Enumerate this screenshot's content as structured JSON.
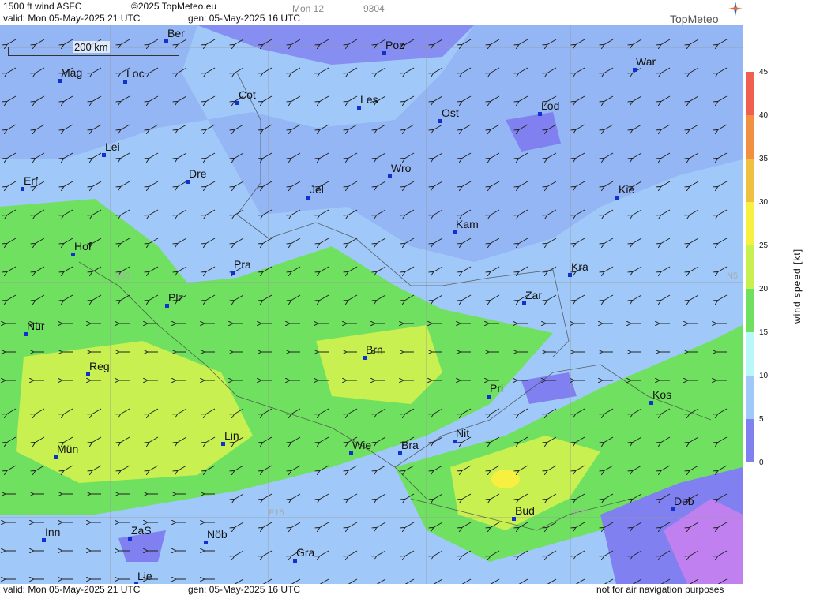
{
  "header": {
    "product": "1500 ft wind ASFC",
    "copyright": "©2025 TopMeteo.eu",
    "tab": "Mon 12",
    "code": "9304",
    "valid": "valid:  Mon  05-May-2025  21 UTC",
    "gen": "gen:  05-May-2025 16 UTC",
    "brand": "TopMeteo"
  },
  "map": {
    "scale_label": "200 km",
    "grid_labels": [
      {
        "name": "lat-n50",
        "text": "N50"
      },
      {
        "name": "lat-n5-edge",
        "text": "N5"
      },
      {
        "name": "lon-e15",
        "text": "E15"
      },
      {
        "name": "lon-e20",
        "text": "E20"
      }
    ],
    "cities": [
      {
        "label": "Ber"
      },
      {
        "label": "Poz"
      },
      {
        "label": "War"
      },
      {
        "label": "Mag"
      },
      {
        "label": "Loc"
      },
      {
        "label": "Cot"
      },
      {
        "label": "Les"
      },
      {
        "label": "Ost"
      },
      {
        "label": "Lod"
      },
      {
        "label": "Lei"
      },
      {
        "label": "Dre"
      },
      {
        "label": "Wro"
      },
      {
        "label": "Erf"
      },
      {
        "label": "Jel"
      },
      {
        "label": "Kie"
      },
      {
        "label": "Kam"
      },
      {
        "label": "Hof"
      },
      {
        "label": "Pra"
      },
      {
        "label": "Kra"
      },
      {
        "label": "Zar"
      },
      {
        "label": "Plz"
      },
      {
        "label": "Nür"
      },
      {
        "label": "Brn"
      },
      {
        "label": "Reg"
      },
      {
        "label": "Pri"
      },
      {
        "label": "Kos"
      },
      {
        "label": "Nit"
      },
      {
        "label": "Lin"
      },
      {
        "label": "Mün"
      },
      {
        "label": "Wie"
      },
      {
        "label": "Bra"
      },
      {
        "label": "Bud"
      },
      {
        "label": "Deb"
      },
      {
        "label": "Nöb"
      },
      {
        "label": "Inn"
      },
      {
        "label": "ZaS"
      },
      {
        "label": "Gra"
      },
      {
        "label": "Lie"
      }
    ]
  },
  "legend": {
    "unit": "wind  speed  [kt]",
    "ticks": [
      "45",
      "40",
      "35",
      "30",
      "25",
      "20",
      "15",
      "10",
      "5",
      "0"
    ],
    "colors": {
      "45": "#f06050",
      "40": "#f09040",
      "35": "#f0c040",
      "30": "#f8f040",
      "25": "#c8f050",
      "20": "#70e060",
      "15": "#b8f8f8",
      "10": "#a0c8f8",
      "5": "#8080f0",
      "0": "#c080f0"
    }
  },
  "footer": {
    "valid": "valid:  Mon  05-May-2025  21 UTC",
    "gen": "gen:  05-May-2025 16 UTC",
    "disclaimer": "not for air navigation purposes"
  }
}
